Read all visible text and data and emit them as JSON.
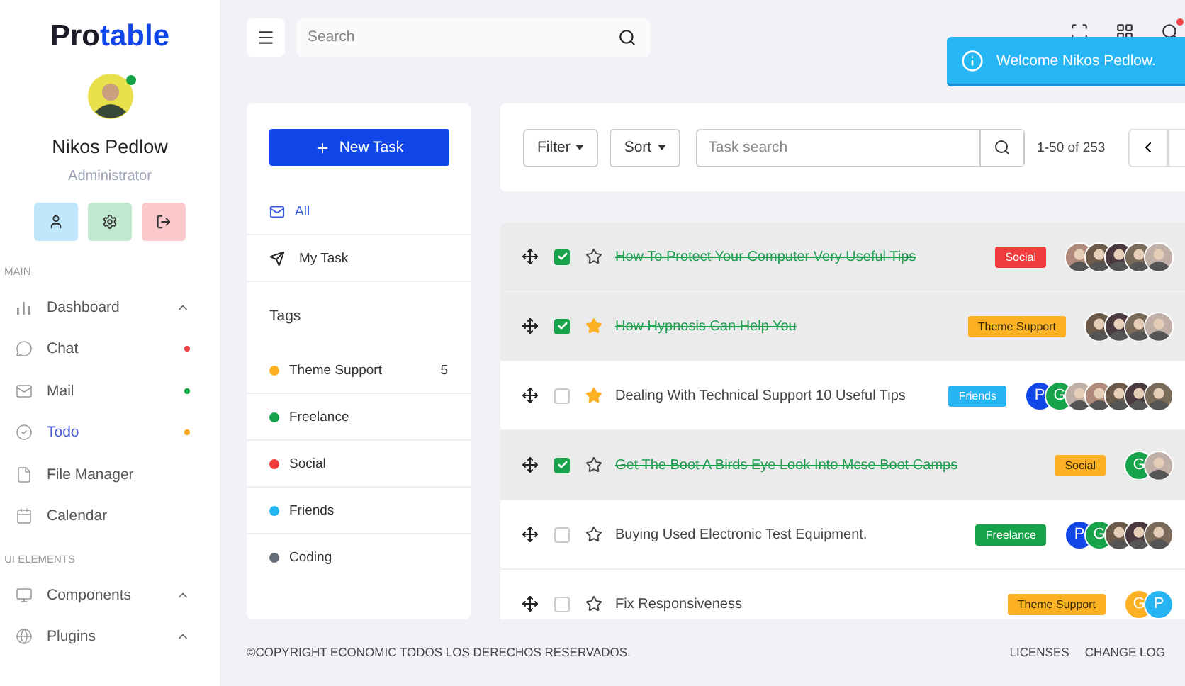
{
  "sidebar": {
    "logo": {
      "dark": "Pro",
      "accent": "table"
    },
    "profile": {
      "name": "Nikos Pedlow",
      "role": "Administrator",
      "online": true
    },
    "sections": [
      {
        "title": "MAIN",
        "items": [
          {
            "label": "Dashboard",
            "selected": false,
            "has_submenu": true
          },
          {
            "label": "Chat",
            "selected": false,
            "has_submenu": false,
            "color": "#ef4444"
          },
          {
            "label": "Mail",
            "selected": false,
            "has_submenu": false,
            "color": "#16a34a"
          },
          {
            "label": "Todo",
            "selected": true,
            "has_submenu": false,
            "color": "#f9a825"
          },
          {
            "label": "File Manager",
            "selected": false,
            "has_submenu": false
          },
          {
            "label": "Calendar",
            "selected": false,
            "has_submenu": false
          }
        ]
      },
      {
        "title": "UI ELEMENTS",
        "items": [
          {
            "label": "Components",
            "selected": false,
            "has_submenu": true
          },
          {
            "label": "Plugins",
            "selected": false,
            "has_submenu": true
          }
        ]
      }
    ]
  },
  "header": {
    "search": {
      "placeholder": "Search"
    },
    "notification": true
  },
  "toast": {
    "message": "Welcome Nikos Pedlow."
  },
  "todo_nav": {
    "new_button": "New Task",
    "filters": [
      {
        "label": "All",
        "selected": true
      },
      {
        "label": "My Task",
        "selected": false
      }
    ],
    "tags_title": "Tags",
    "tags": [
      {
        "label": "Theme Support",
        "color": "#fbb123",
        "count": "5"
      },
      {
        "label": "Freelance",
        "color": "#16a34a"
      },
      {
        "label": "Social",
        "color": "#ef3b3b"
      },
      {
        "label": "Friends",
        "color": "#27b4f2"
      },
      {
        "label": "Coding",
        "color": "#676d78"
      }
    ]
  },
  "toolbar": {
    "filter": "Filter",
    "sort": "Sort",
    "search": {
      "placeholder": "Task search"
    },
    "range": "1-50 of 253"
  },
  "tasks": [
    {
      "title": "How To Protect Your Computer Very Useful Tips",
      "checked": true,
      "starred": false,
      "tag": {
        "label": "Social",
        "color": "#ef3b3b"
      },
      "avatars": [
        {
          "kind": "photo"
        },
        {
          "kind": "photo"
        },
        {
          "kind": "photo"
        },
        {
          "kind": "photo"
        },
        {
          "kind": "photo"
        }
      ]
    },
    {
      "title": "How Hypnosis Can Help You",
      "checked": true,
      "starred": true,
      "tag": {
        "label": "Theme Support",
        "color": "#fbb123"
      },
      "avatars": [
        {
          "kind": "photo"
        },
        {
          "kind": "photo"
        },
        {
          "kind": "photo"
        },
        {
          "kind": "photo"
        }
      ]
    },
    {
      "title": "Dealing With Technical Support 10 Useful Tips",
      "checked": false,
      "starred": true,
      "tag": {
        "label": "Friends",
        "color": "#27b4f2"
      },
      "avatars": [
        {
          "kind": "letter",
          "letter": "P",
          "color": "#1146e8"
        },
        {
          "kind": "letter",
          "letter": "G",
          "color": "#16a34a"
        },
        {
          "kind": "photo"
        },
        {
          "kind": "photo"
        },
        {
          "kind": "photo"
        },
        {
          "kind": "photo"
        },
        {
          "kind": "photo"
        }
      ]
    },
    {
      "title": "Get The Boot A Birds Eye Look Into Mcse Boot Camps",
      "checked": true,
      "starred": false,
      "tag": {
        "label": "Social",
        "color": "#fbb123"
      },
      "avatars": [
        {
          "kind": "letter",
          "letter": "G",
          "color": "#16a34a"
        },
        {
          "kind": "photo"
        }
      ]
    },
    {
      "title": "Buying Used Electronic Test Equipment.",
      "checked": false,
      "starred": false,
      "tag": {
        "label": "Freelance",
        "color": "#16a34a"
      },
      "avatars": [
        {
          "kind": "letter",
          "letter": "P",
          "color": "#1146e8"
        },
        {
          "kind": "letter",
          "letter": "G",
          "color": "#16a34a"
        },
        {
          "kind": "photo"
        },
        {
          "kind": "photo"
        },
        {
          "kind": "photo"
        }
      ]
    },
    {
      "title": "Fix Responsiveness",
      "checked": false,
      "starred": false,
      "tag": {
        "label": "Theme Support",
        "color": "#fbb123"
      },
      "avatars": [
        {
          "kind": "letter",
          "letter": "G",
          "color": "#fbb123"
        },
        {
          "kind": "letter",
          "letter": "P",
          "color": "#27b4f2"
        }
      ]
    }
  ],
  "footer": {
    "copyright": "©COPYRIGHT ECONOMIC TODOS LOS DERECHOS RESERVADOS.",
    "links": [
      "LICENSES",
      "CHANGE LOG"
    ]
  }
}
